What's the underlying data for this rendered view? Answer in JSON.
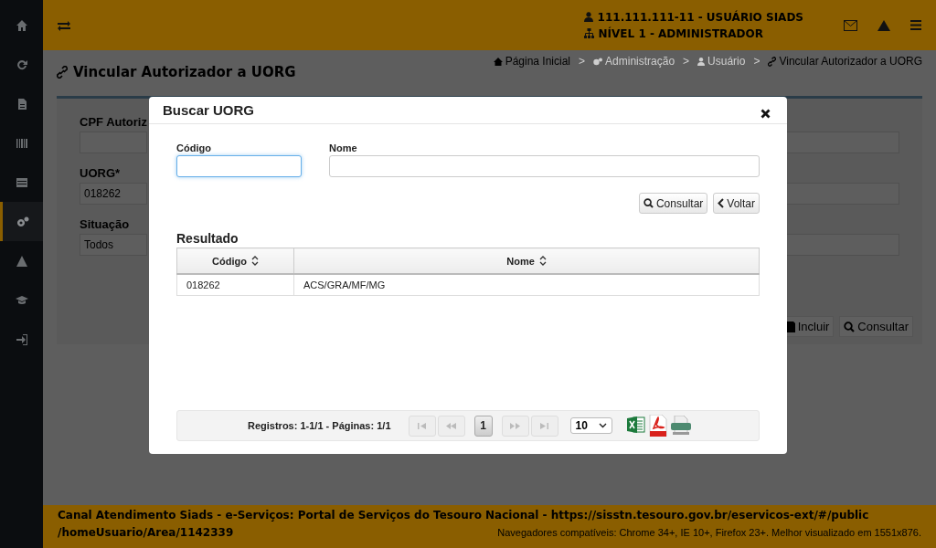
{
  "header": {
    "user": "111.111.111-11 - USUÁRIO SIADS",
    "level": "NÍVEL 1 - ADMINISTRADOR"
  },
  "sidebar": {
    "items": [
      {
        "kind": "home",
        "selected": false
      },
      {
        "kind": "refresh",
        "selected": false
      },
      {
        "kind": "document",
        "selected": false
      },
      {
        "kind": "barcode",
        "selected": false
      },
      {
        "kind": "table",
        "selected": false
      },
      {
        "kind": "gears",
        "selected": true
      },
      {
        "kind": "warning",
        "selected": false
      },
      {
        "kind": "graduation",
        "selected": false
      },
      {
        "kind": "signin",
        "selected": false
      }
    ]
  },
  "page": {
    "title": "Vincular Autorizador a UORG",
    "breadcrumb": [
      {
        "kind": "home",
        "label": "Página Inicial",
        "disabled": false
      },
      {
        "kind": "separator",
        "label": ">"
      },
      {
        "kind": "gears",
        "label": "Administração",
        "disabled": true
      },
      {
        "kind": "separator",
        "label": ">"
      },
      {
        "kind": "user",
        "label": "Usuário",
        "disabled": true
      },
      {
        "kind": "separator",
        "label": ">"
      },
      {
        "kind": "link",
        "label": "Vincular Autorizador a UORG",
        "disabled": false
      }
    ],
    "form": [
      {
        "label": "CPF Autoriz"
      },
      {
        "label": "UORG*",
        "value": "018262"
      },
      {
        "label": "Situação",
        "value": "Todos"
      }
    ],
    "buttons": [
      {
        "kind": "save",
        "label": "Incluir"
      },
      {
        "kind": "search",
        "label": "Consultar"
      }
    ]
  },
  "modal": {
    "title": "Buscar UORG",
    "fields": [
      {
        "label": "Código",
        "focused": true
      },
      {
        "label": "Nome",
        "focused": false
      }
    ],
    "buttons": [
      {
        "kind": "search",
        "label": "Consultar"
      },
      {
        "kind": "back",
        "label": "Voltar"
      }
    ],
    "result_title": "Resultado",
    "table": {
      "columns": [
        "Código",
        "Nome"
      ],
      "rows": [
        [
          "018262",
          "ACS/GRA/MF/MG"
        ]
      ]
    },
    "pagination": {
      "summary": "Registros: 1-1/1 - Páginas: 1/1",
      "controls": [
        {
          "kind": "first",
          "disabled": true
        },
        {
          "kind": "prev",
          "disabled": true
        },
        {
          "kind": "page",
          "label": "1",
          "selected": true
        },
        {
          "kind": "next",
          "disabled": true
        },
        {
          "kind": "last",
          "disabled": true
        }
      ],
      "page_size": "10"
    }
  },
  "footer": {
    "line1": "Canal Atendimento Siads - e-Serviços: Portal de Serviços do Tesouro Nacional - https://sisstn.tesouro.gov.br/eservicos-ext/#/public",
    "line2": "/homeUsuario/Area/1142339",
    "note": "Navegadores compatíveis: Chrome 34+, IE 10+, Firefox 23+. Melhor visualizado em 1551x876."
  }
}
